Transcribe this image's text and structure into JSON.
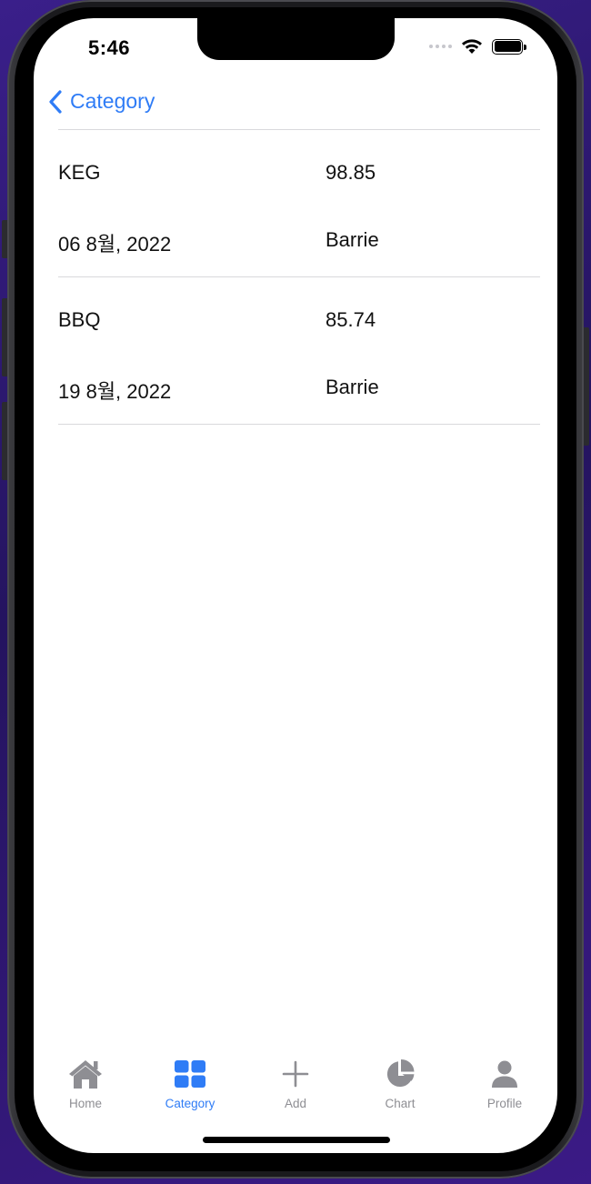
{
  "status": {
    "time": "5:46"
  },
  "nav": {
    "back_label": "Category"
  },
  "rows": [
    {
      "title": "KEG",
      "amount": "98.85",
      "date": "06 8월, 2022",
      "place": "Barrie"
    },
    {
      "title": "BBQ",
      "amount": "85.74",
      "date": "19 8월, 2022",
      "place": "Barrie"
    }
  ],
  "tabs": [
    {
      "label": "Home",
      "icon": "house-icon"
    },
    {
      "label": "Category",
      "icon": "grid-icon",
      "active": true
    },
    {
      "label": "Add",
      "icon": "plus-icon"
    },
    {
      "label": "Chart",
      "icon": "pie-chart-icon"
    },
    {
      "label": "Profile",
      "icon": "person-icon"
    }
  ],
  "colors": {
    "accent": "#2f7cf6",
    "inactive": "#8e8e93",
    "divider": "#d9d9dc"
  }
}
